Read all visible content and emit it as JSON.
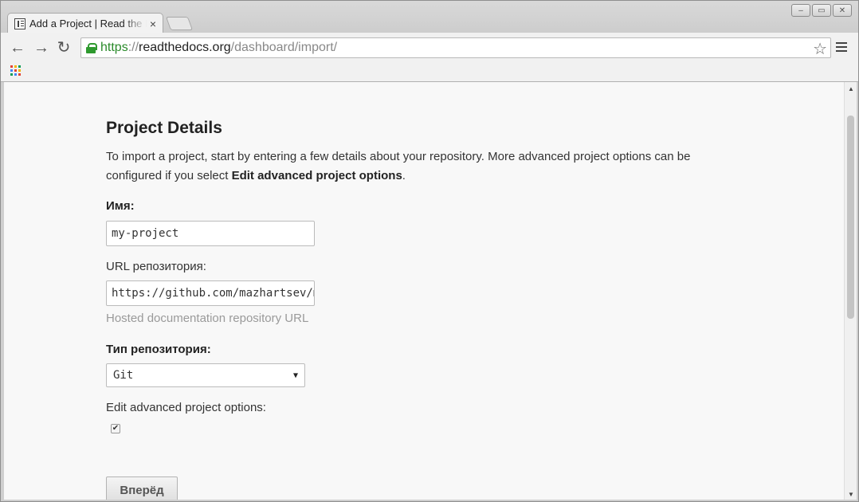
{
  "browser": {
    "tab_title": "Add a Project | Read the Docs",
    "url_scheme": "https",
    "url_sep": "://",
    "url_host": "readthedocs.org",
    "url_path": "/dashboard/import/"
  },
  "page": {
    "heading": "Project Details",
    "intro_text": "To import a project, start by entering a few details about your repository. More advanced project options can be configured if you select ",
    "intro_bold": "Edit advanced project options",
    "intro_end": ".",
    "name_label": "Имя:",
    "name_value": "my-project",
    "repo_url_label": "URL репозитория:",
    "repo_url_value": "https://github.com/mazhartsev/my-project",
    "repo_url_help": "Hosted documentation repository URL",
    "repo_type_label": "Тип репозитория:",
    "repo_type_value": "Git",
    "advanced_label": "Edit advanced project options:",
    "advanced_checked": "✔",
    "submit_label": "Вперёд"
  },
  "icons": {
    "back": "←",
    "forward": "→",
    "reload": "↻",
    "star": "☆",
    "close": "×",
    "caret": "▼",
    "scroll_up": "▲",
    "scroll_down": "▼"
  }
}
